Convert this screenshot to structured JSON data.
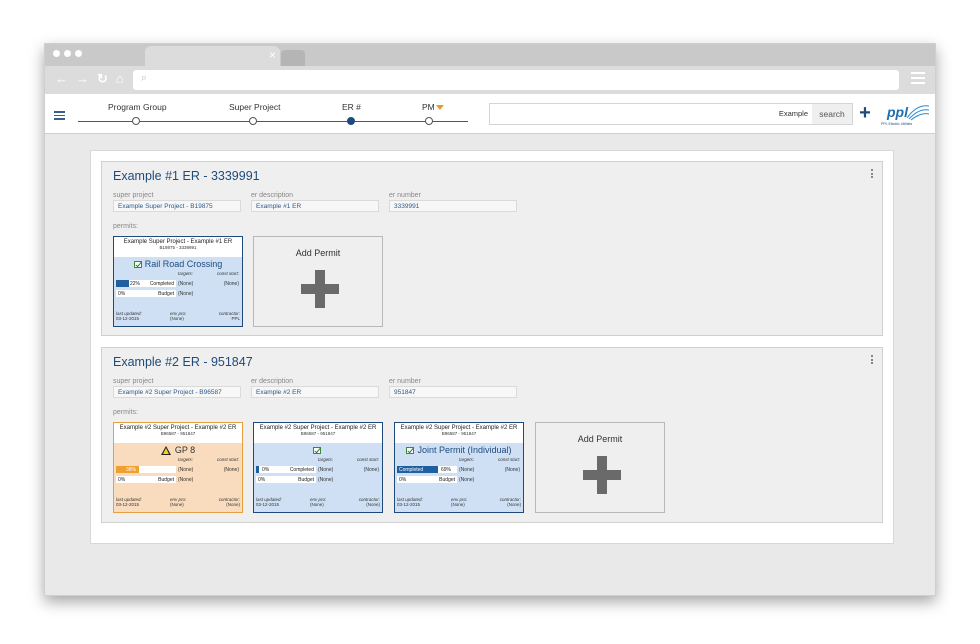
{
  "browser": {
    "tab_close": "×",
    "nav": {
      "back": "←",
      "forward": "→",
      "reload": "↻",
      "home": "⌂"
    },
    "url_icon": "⌕"
  },
  "header": {
    "steps": [
      {
        "label": "Program Group",
        "active": false
      },
      {
        "label": "Super Project",
        "active": false
      },
      {
        "label": "ER #",
        "active": true
      },
      {
        "label": "PM",
        "active": false
      }
    ],
    "search_value": "Example",
    "search_button": "search",
    "add_button": "+",
    "logo_text": "ppl",
    "logo_sub": "PPL Electric Utilities"
  },
  "field_labels": {
    "super_project": "super project",
    "er_description": "er description",
    "er_number": "er number",
    "permits": "permits:"
  },
  "permit_labels": {
    "targets": "targets:",
    "const_start": "const start:",
    "completed": "Completed",
    "budget": "Budget",
    "last_updated": "last updated:",
    "env_pro": "env pro:",
    "contractor": "contractor:",
    "none": "(None)"
  },
  "add_permit_label": "Add Permit",
  "ers": [
    {
      "title": "Example #1 ER - 3339991",
      "super_project": "Example Super Project - B19875",
      "er_description": "Example #1 ER",
      "er_number": "3339991",
      "permits": [
        {
          "title": "Example Super Project - Example #1 ER",
          "subtitle": "B19875 - 3339991",
          "name": "Rail Road Crossing",
          "status_icon": "check",
          "color": "blue",
          "completed_pct": "22%",
          "completed_fill": 0.22,
          "completed_label": "Completed",
          "completed_target": "(None)",
          "const_start": "(None)",
          "budget_pct": "0%",
          "budget_fill": 0,
          "budget_target": "(None)",
          "last_updated": "03-12-2015",
          "env_pro": "(None)",
          "contractor": "PPL"
        }
      ]
    },
    {
      "title": "Example #2 ER - 951847",
      "super_project": "Example #2 Super Project - B96587",
      "er_description": "Example #2 ER",
      "er_number": "951847",
      "permits": [
        {
          "title": "Example #2 Super Project - Example #2 ER",
          "subtitle": "B96587 - 951847",
          "name": "GP 8",
          "status_icon": "warning",
          "color": "orange",
          "completed_pct": "38%",
          "completed_fill": 0.38,
          "completed_label": "",
          "completed_target": "(None)",
          "const_start": "(None)",
          "budget_pct": "0%",
          "budget_fill": 0,
          "budget_target": "(None)",
          "last_updated": "03-12-2015",
          "env_pro": "(None)",
          "contractor": "(None)"
        },
        {
          "title": "Example #2 Super Project - Example #2 ER",
          "subtitle": "B96587 - 951847",
          "name": "",
          "status_icon": "check",
          "color": "blue",
          "completed_pct": "0%",
          "completed_fill": 0.05,
          "completed_label": "Completed",
          "completed_target": "(None)",
          "const_start": "(None)",
          "budget_pct": "0%",
          "budget_fill": 0,
          "budget_target": "(None)",
          "last_updated": "03-12-2015",
          "env_pro": "(None)",
          "contractor": "(None)"
        },
        {
          "title": "Example #2 Super Project - Example #2 ER",
          "subtitle": "B96587 - 951847",
          "name": "Joint Permit (Individual)",
          "status_icon": "check",
          "color": "blue",
          "completed_pct": "69%",
          "completed_fill": 0.69,
          "completed_label": "Completed",
          "completed_target": "(None)",
          "const_start": "(None)",
          "budget_pct": "0%",
          "budget_fill": 0,
          "budget_target": "(None)",
          "last_updated": "03-12-2015",
          "env_pro": "(None)",
          "contractor": "(None)"
        }
      ]
    }
  ]
}
